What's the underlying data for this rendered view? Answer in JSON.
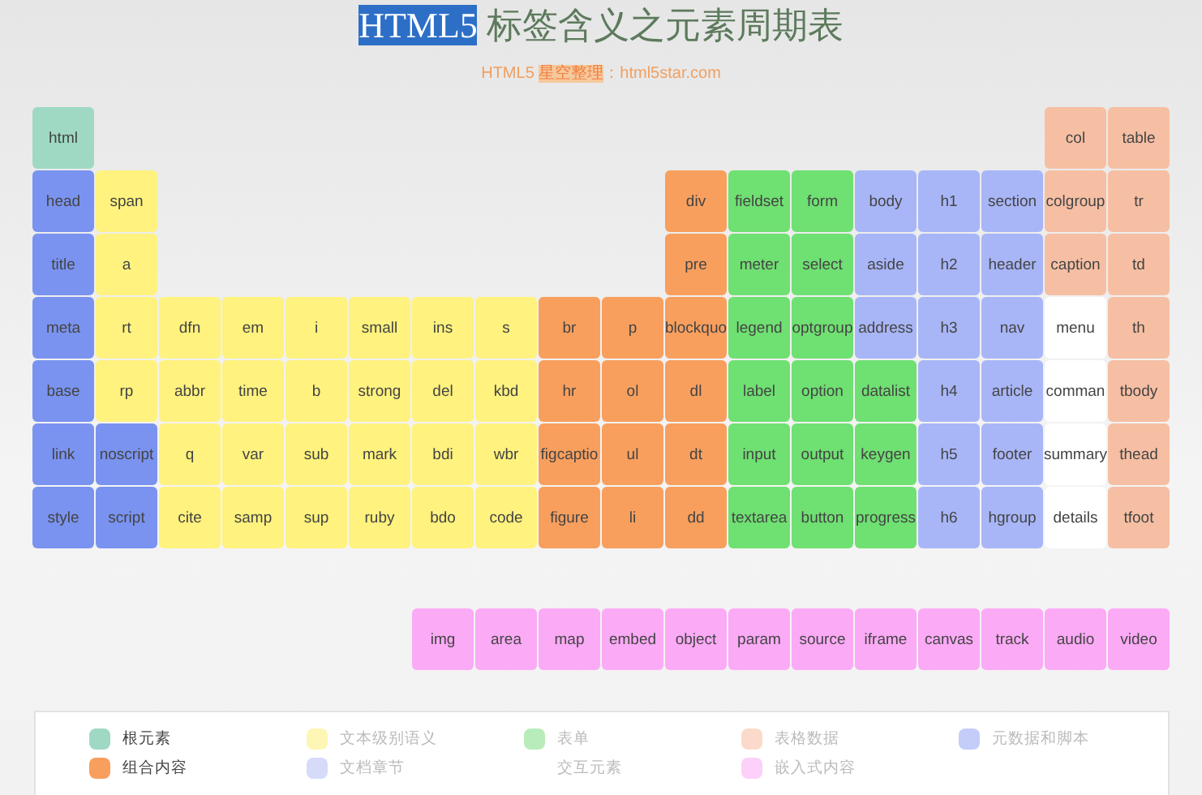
{
  "title": {
    "segments": [
      {
        "text": "HTML5",
        "selected": true
      },
      {
        "text": " 标签含义之元素周期表",
        "selected": false
      }
    ]
  },
  "subtitle": {
    "segments": [
      {
        "text": "HTML5 ",
        "selected": false
      },
      {
        "text": "星空整理",
        "selected": true
      },
      {
        "text": "：html5star.com",
        "selected": false
      }
    ]
  },
  "table": {
    "rows": [
      {
        "groups": [
          [
            {
              "label": "html",
              "color": "#9fd9c4"
            }
          ],
          [
            {
              "label": "col",
              "color": "#f6bfa3"
            },
            {
              "label": "table",
              "color": "#f6bfa3"
            }
          ]
        ]
      },
      {
        "groups": [
          [
            {
              "label": "head",
              "color": "#7a93f0"
            },
            {
              "label": "span",
              "color": "#fff27e"
            }
          ],
          [
            {
              "label": "div",
              "color": "#f89f5e"
            },
            {
              "label": "fieldset",
              "color": "#6fe072"
            },
            {
              "label": "form",
              "color": "#6fe072"
            },
            {
              "label": "body",
              "color": "#a8b6f7"
            },
            {
              "label": "h1",
              "color": "#a8b6f7"
            },
            {
              "label": "section",
              "color": "#a8b6f7"
            },
            {
              "label": "colgroup",
              "color": "#f6bfa3"
            },
            {
              "label": "tr",
              "color": "#f6bfa3"
            }
          ]
        ]
      },
      {
        "groups": [
          [
            {
              "label": "title",
              "color": "#7a93f0"
            },
            {
              "label": "a",
              "color": "#fff27e"
            }
          ],
          [
            {
              "label": "pre",
              "color": "#f89f5e"
            },
            {
              "label": "meter",
              "color": "#6fe072"
            },
            {
              "label": "select",
              "color": "#6fe072"
            },
            {
              "label": "aside",
              "color": "#a8b6f7"
            },
            {
              "label": "h2",
              "color": "#a8b6f7"
            },
            {
              "label": "header",
              "color": "#a8b6f7"
            },
            {
              "label": "caption",
              "color": "#f6bfa3"
            },
            {
              "label": "td",
              "color": "#f6bfa3"
            }
          ]
        ]
      },
      {
        "groups": [
          [
            {
              "label": "meta",
              "color": "#7a93f0"
            },
            {
              "label": "rt",
              "color": "#fff27e"
            },
            {
              "label": "dfn",
              "color": "#fff27e"
            },
            {
              "label": "em",
              "color": "#fff27e"
            },
            {
              "label": "i",
              "color": "#fff27e"
            },
            {
              "label": "small",
              "color": "#fff27e"
            },
            {
              "label": "ins",
              "color": "#fff27e"
            },
            {
              "label": "s",
              "color": "#fff27e"
            },
            {
              "label": "br",
              "color": "#f89f5e"
            },
            {
              "label": "p",
              "color": "#f89f5e"
            },
            {
              "label": "blockquo",
              "color": "#f89f5e"
            },
            {
              "label": "legend",
              "color": "#6fe072"
            },
            {
              "label": "optgroup",
              "color": "#6fe072"
            },
            {
              "label": "address",
              "color": "#a8b6f7"
            },
            {
              "label": "h3",
              "color": "#a8b6f7"
            },
            {
              "label": "nav",
              "color": "#a8b6f7"
            },
            {
              "label": "menu",
              "color": "#ffffff"
            },
            {
              "label": "th",
              "color": "#f6bfa3"
            }
          ]
        ]
      },
      {
        "groups": [
          [
            {
              "label": "base",
              "color": "#7a93f0"
            },
            {
              "label": "rp",
              "color": "#fff27e"
            },
            {
              "label": "abbr",
              "color": "#fff27e"
            },
            {
              "label": "time",
              "color": "#fff27e"
            },
            {
              "label": "b",
              "color": "#fff27e"
            },
            {
              "label": "strong",
              "color": "#fff27e"
            },
            {
              "label": "del",
              "color": "#fff27e"
            },
            {
              "label": "kbd",
              "color": "#fff27e"
            },
            {
              "label": "hr",
              "color": "#f89f5e"
            },
            {
              "label": "ol",
              "color": "#f89f5e"
            },
            {
              "label": "dl",
              "color": "#f89f5e"
            },
            {
              "label": "label",
              "color": "#6fe072"
            },
            {
              "label": "option",
              "color": "#6fe072"
            },
            {
              "label": "datalist",
              "color": "#6fe072"
            },
            {
              "label": "h4",
              "color": "#a8b6f7"
            },
            {
              "label": "article",
              "color": "#a8b6f7"
            },
            {
              "label": "comman",
              "color": "#ffffff"
            },
            {
              "label": "tbody",
              "color": "#f6bfa3"
            }
          ]
        ]
      },
      {
        "groups": [
          [
            {
              "label": "link",
              "color": "#7a93f0"
            },
            {
              "label": "noscript",
              "color": "#7a93f0"
            },
            {
              "label": "q",
              "color": "#fff27e"
            },
            {
              "label": "var",
              "color": "#fff27e"
            },
            {
              "label": "sub",
              "color": "#fff27e"
            },
            {
              "label": "mark",
              "color": "#fff27e"
            },
            {
              "label": "bdi",
              "color": "#fff27e"
            },
            {
              "label": "wbr",
              "color": "#fff27e"
            },
            {
              "label": "figcaptio",
              "color": "#f89f5e"
            },
            {
              "label": "ul",
              "color": "#f89f5e"
            },
            {
              "label": "dt",
              "color": "#f89f5e"
            },
            {
              "label": "input",
              "color": "#6fe072"
            },
            {
              "label": "output",
              "color": "#6fe072"
            },
            {
              "label": "keygen",
              "color": "#6fe072"
            },
            {
              "label": "h5",
              "color": "#a8b6f7"
            },
            {
              "label": "footer",
              "color": "#a8b6f7"
            },
            {
              "label": "summary",
              "color": "#ffffff"
            },
            {
              "label": "thead",
              "color": "#f6bfa3"
            }
          ]
        ]
      },
      {
        "groups": [
          [
            {
              "label": "style",
              "color": "#7a93f0"
            },
            {
              "label": "script",
              "color": "#7a93f0"
            },
            {
              "label": "cite",
              "color": "#fff27e"
            },
            {
              "label": "samp",
              "color": "#fff27e"
            },
            {
              "label": "sup",
              "color": "#fff27e"
            },
            {
              "label": "ruby",
              "color": "#fff27e"
            },
            {
              "label": "bdo",
              "color": "#fff27e"
            },
            {
              "label": "code",
              "color": "#fff27e"
            },
            {
              "label": "figure",
              "color": "#f89f5e"
            },
            {
              "label": "li",
              "color": "#f89f5e"
            },
            {
              "label": "dd",
              "color": "#f89f5e"
            },
            {
              "label": "textarea",
              "color": "#6fe072"
            },
            {
              "label": "button",
              "color": "#6fe072"
            },
            {
              "label": "progress",
              "color": "#6fe072"
            },
            {
              "label": "h6",
              "color": "#a8b6f7"
            },
            {
              "label": "hgroup",
              "color": "#a8b6f7"
            },
            {
              "label": "details",
              "color": "#ffffff"
            },
            {
              "label": "tfoot",
              "color": "#f6bfa3"
            }
          ]
        ]
      }
    ],
    "embedded_row": [
      {
        "label": "img",
        "color": "#fbaaf6"
      },
      {
        "label": "area",
        "color": "#fbaaf6"
      },
      {
        "label": "map",
        "color": "#fbaaf6"
      },
      {
        "label": "embed",
        "color": "#fbaaf6"
      },
      {
        "label": "object",
        "color": "#fbaaf6"
      },
      {
        "label": "param",
        "color": "#fbaaf6"
      },
      {
        "label": "source",
        "color": "#fbaaf6"
      },
      {
        "label": "iframe",
        "color": "#fbaaf6"
      },
      {
        "label": "canvas",
        "color": "#fbaaf6"
      },
      {
        "label": "track",
        "color": "#fbaaf6"
      },
      {
        "label": "audio",
        "color": "#fbaaf6"
      },
      {
        "label": "video",
        "color": "#fbaaf6"
      }
    ]
  },
  "legend": [
    {
      "label": "根元素",
      "color": "#9fd9c4",
      "dimmed": false
    },
    {
      "label": "文本级别语义",
      "color": "#fdf6b4",
      "dimmed": true
    },
    {
      "label": "表单",
      "color": "#b8ecbb",
      "dimmed": true
    },
    {
      "label": "表格数据",
      "color": "#fbdacb",
      "dimmed": true
    },
    {
      "label": "元数据和脚本",
      "color": "#c4cdf8",
      "dimmed": true
    },
    {
      "label": "组合内容",
      "color": "#f89f5e",
      "dimmed": false
    },
    {
      "label": "文档章节",
      "color": "#d6dbfa",
      "dimmed": true
    },
    {
      "label": "交互元素",
      "dimmed": true
    },
    {
      "label": "嵌入式内容",
      "color": "#fcd0f9",
      "dimmed": true
    }
  ]
}
